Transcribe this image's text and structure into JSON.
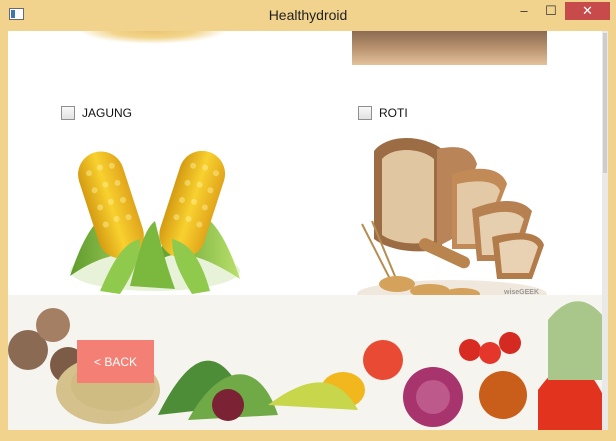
{
  "window": {
    "title": "Healthydroid",
    "minimize_label": "‒",
    "maximize_label": "☐",
    "close_label": "✕"
  },
  "items": [
    {
      "label": "JAGUNG",
      "checked": false
    },
    {
      "label": "ROTI",
      "checked": false
    }
  ],
  "actions": {
    "back_label": "< BACK"
  },
  "watermark": "wiseGEEK",
  "colors": {
    "titlebar": "#f1d38e",
    "back_button": "#f47f74",
    "close_button": "#c74b4b"
  },
  "icons": [
    "app-icon",
    "minimize-icon",
    "maximize-icon",
    "close-icon"
  ]
}
